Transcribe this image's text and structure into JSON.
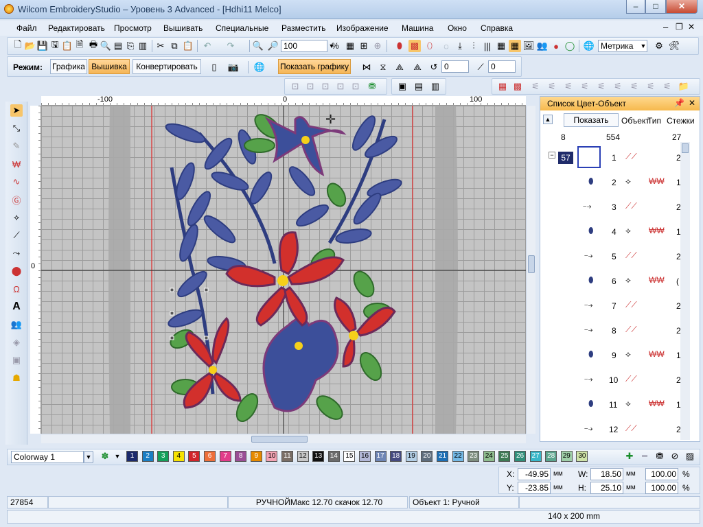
{
  "window": {
    "title": "Wilcom EmbroideryStudio – Уровень 3 Advanced - [Hdhi11          Melco]",
    "min": "–",
    "max": "□",
    "close": "✕"
  },
  "menu": [
    "Файл",
    "Редактировать",
    "Просмотр",
    "Вышивать",
    "Специальные",
    "Разместить",
    "Изображение",
    "Машина",
    "Окно",
    "Справка"
  ],
  "toolbar": {
    "zoom_value": "100",
    "zoom_unit": "%",
    "units": "Метрика",
    "rotate_value": "0",
    "slant_value": "0"
  },
  "mode": {
    "label": "Режим:",
    "graphics": "Графика",
    "embroidery": "Вышивка",
    "convert": "Конвертировать",
    "show_graphics": "Показать графику"
  },
  "ruler": {
    "h_ticks": [
      "-100",
      "0",
      "100"
    ],
    "v_ticks": [
      "0"
    ]
  },
  "panel": {
    "title": "Список Цвет-Объект",
    "show_button": "Показать",
    "col_object": "Объект",
    "col_type": "Тип",
    "col_stitches": "Стежки",
    "header_row": {
      "a": "8",
      "b": "554",
      "c": "27"
    },
    "group_num": "57",
    "rows": [
      {
        "n": "1",
        "t": "2"
      },
      {
        "n": "2",
        "t": "1"
      },
      {
        "n": "3",
        "t": "2"
      },
      {
        "n": "4",
        "t": "1"
      },
      {
        "n": "5",
        "t": "2"
      },
      {
        "n": "6",
        "t": "("
      },
      {
        "n": "7",
        "t": "2"
      },
      {
        "n": "8",
        "t": "2"
      },
      {
        "n": "9",
        "t": "1"
      },
      {
        "n": "10",
        "t": "2"
      },
      {
        "n": "11",
        "t": "1"
      },
      {
        "n": "12",
        "t": "2"
      }
    ]
  },
  "colorway": {
    "selected": "Colorway 1"
  },
  "palette": [
    {
      "n": "1",
      "c": "#1c2a6c"
    },
    {
      "n": "2",
      "c": "#1b7fc4"
    },
    {
      "n": "3",
      "c": "#15a05a"
    },
    {
      "n": "4",
      "c": "#f7e200"
    },
    {
      "n": "5",
      "c": "#d2252a"
    },
    {
      "n": "6",
      "c": "#ee6f3a"
    },
    {
      "n": "7",
      "c": "#e23d8a"
    },
    {
      "n": "8",
      "c": "#9b4f96"
    },
    {
      "n": "9",
      "c": "#e68a00"
    },
    {
      "n": "10",
      "c": "#f3a3b3"
    },
    {
      "n": "11",
      "c": "#7a6e65"
    },
    {
      "n": "12",
      "c": "#c8c8c8"
    },
    {
      "n": "13",
      "c": "#111111"
    },
    {
      "n": "14",
      "c": "#6b6b6b"
    },
    {
      "n": "15",
      "c": "#ffffff"
    },
    {
      "n": "16",
      "c": "#b3b8d8"
    },
    {
      "n": "17",
      "c": "#6f86b5"
    },
    {
      "n": "18",
      "c": "#454a80"
    },
    {
      "n": "19",
      "c": "#b3cfe6"
    },
    {
      "n": "20",
      "c": "#5e6d7d"
    },
    {
      "n": "21",
      "c": "#1d6fb5"
    },
    {
      "n": "22",
      "c": "#73b9e6"
    },
    {
      "n": "23",
      "c": "#7f8f80"
    },
    {
      "n": "24",
      "c": "#8ebd8e"
    },
    {
      "n": "25",
      "c": "#3e7b54"
    },
    {
      "n": "26",
      "c": "#2f8f7a"
    },
    {
      "n": "27",
      "c": "#39b7c9"
    },
    {
      "n": "28",
      "c": "#5aa58e"
    },
    {
      "n": "29",
      "c": "#9fcfa8"
    },
    {
      "n": "30",
      "c": "#cfe3a8"
    }
  ],
  "coords": {
    "x_label": "X:",
    "x": "-49.95",
    "y_label": "Y:",
    "y": "-23.85",
    "unit": "мм",
    "w_label": "W:",
    "w": "18.50",
    "h_label": "H:",
    "h": "25.10",
    "wp": "100.00",
    "hp": "100.00",
    "pct": "%"
  },
  "status": {
    "stitches": "27854",
    "info": "РУЧНОЙМакс 12.70 скачок 12.70",
    "object": "Объект 1: Ручной",
    "size": "140 x 200 mm"
  }
}
